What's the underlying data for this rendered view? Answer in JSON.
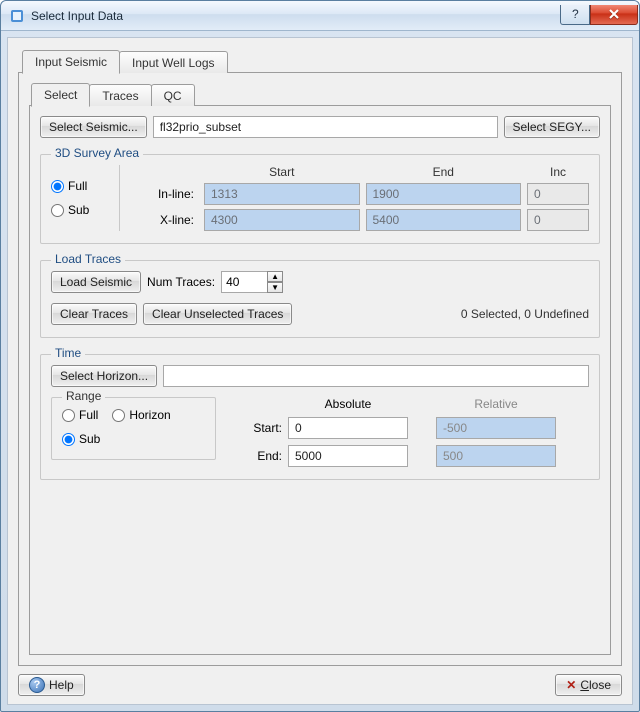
{
  "window": {
    "title": "Select Input Data"
  },
  "outerTabs": {
    "items": [
      {
        "label": "Input Seismic",
        "active": true
      },
      {
        "label": "Input Well Logs",
        "active": false
      }
    ]
  },
  "innerTabs": {
    "items": [
      {
        "label": "Select",
        "active": true
      },
      {
        "label": "Traces",
        "active": false
      },
      {
        "label": "QC",
        "active": false
      }
    ]
  },
  "seismicRow": {
    "selectSeismicBtn": "Select Seismic...",
    "seismicName": "fl32prio_subset",
    "selectSegyBtn": "Select SEGY..."
  },
  "surveyArea": {
    "legend": "3D Survey Area",
    "full": "Full",
    "sub": "Sub",
    "selected": "full",
    "headers": {
      "start": "Start",
      "end": "End",
      "inc": "Inc"
    },
    "inline": {
      "label": "In-line:",
      "start": "1313",
      "end": "1900",
      "inc": "0"
    },
    "xline": {
      "label": "X-line:",
      "start": "4300",
      "end": "5400",
      "inc": "0"
    }
  },
  "loadTraces": {
    "legend": "Load Traces",
    "loadBtn": "Load Seismic",
    "numLabel": "Num Traces:",
    "numValue": "40",
    "clearBtn": "Clear Traces",
    "clearUnselBtn": "Clear Unselected Traces",
    "status": "0 Selected, 0 Undefined"
  },
  "time": {
    "legend": "Time",
    "selectHorizonBtn": "Select Horizon...",
    "horizonName": "",
    "range": {
      "legend": "Range",
      "full": "Full",
      "horizon": "Horizon",
      "sub": "Sub",
      "selected": "sub"
    },
    "cols": {
      "abs": "Absolute",
      "rel": "Relative"
    },
    "start": {
      "label": "Start:",
      "abs": "0",
      "rel": "-500"
    },
    "end": {
      "label": "End:",
      "abs": "5000",
      "rel": "500"
    }
  },
  "footer": {
    "help": "Help",
    "close": "Close"
  }
}
